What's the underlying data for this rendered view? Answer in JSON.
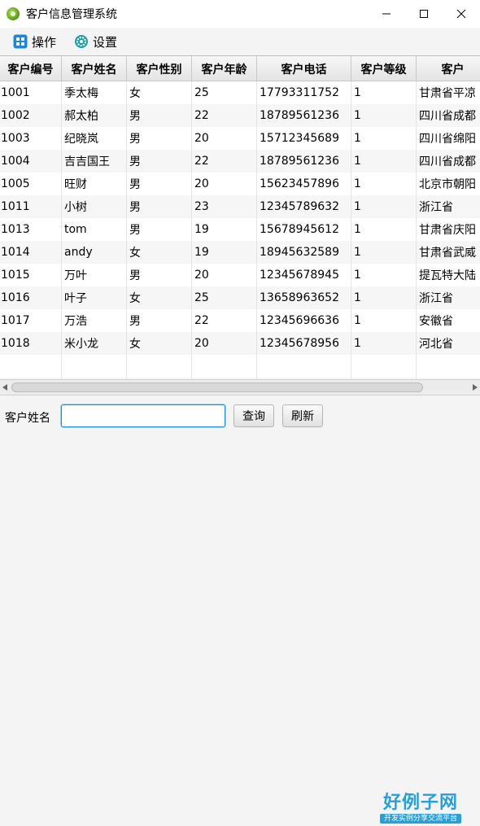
{
  "window": {
    "title": "客户信息管理系统"
  },
  "menu": [
    {
      "label": "操作",
      "icon": "operate-icon"
    },
    {
      "label": "设置",
      "icon": "gear-icon"
    }
  ],
  "table": {
    "columns": [
      "客户编号",
      "客户姓名",
      "客户性别",
      "客户年龄",
      "客户电话",
      "客户等级",
      "客户"
    ],
    "rows": [
      [
        "1001",
        "季太梅",
        "女",
        "25",
        "17793311752",
        "1",
        "甘肃省平凉"
      ],
      [
        "1002",
        "郝太柏",
        "男",
        "22",
        "18789561236",
        "1",
        "四川省成都"
      ],
      [
        "1003",
        "纪晓岚",
        "男",
        "20",
        "15712345689",
        "1",
        "四川省绵阳"
      ],
      [
        "1004",
        "吉吉国王",
        "男",
        "22",
        "18789561236",
        "1",
        "四川省成都"
      ],
      [
        "1005",
        "旺财",
        "男",
        "20",
        "15623457896",
        "1",
        "北京市朝阳"
      ],
      [
        "1011",
        "小树",
        "男",
        "23",
        "12345789632",
        "1",
        "浙江省"
      ],
      [
        "1013",
        "tom",
        "男",
        "19",
        "15678945612",
        "1",
        "甘肃省庆阳"
      ],
      [
        "1014",
        "andy",
        "女",
        "19",
        "18945632589",
        "1",
        "甘肃省武威"
      ],
      [
        "1015",
        "万叶",
        "男",
        "20",
        "12345678945",
        "1",
        "提瓦特大陆"
      ],
      [
        "1016",
        "叶子",
        "女",
        "25",
        "13658963652",
        "1",
        "浙江省"
      ],
      [
        "1017",
        "万浩",
        "男",
        "22",
        "12345696636",
        "1",
        "安徽省"
      ],
      [
        "1018",
        "米小龙",
        "女",
        "20",
        "12345678956",
        "1",
        "河北省"
      ]
    ]
  },
  "search": {
    "label": "客户姓名",
    "value": "",
    "query_label": "查询",
    "refresh_label": "刷新"
  },
  "logo": {
    "main": "好例子网",
    "sub": "开发实例分享交流平台"
  },
  "colors": {
    "accent": "#2a8bd8",
    "logo": "#2a9fd6"
  }
}
